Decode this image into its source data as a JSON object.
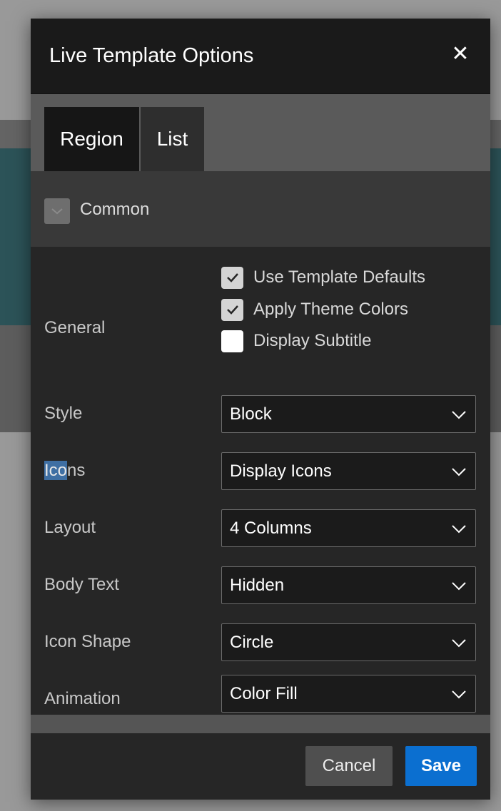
{
  "dialog": {
    "title": "Live Template Options",
    "close_glyph": "✕",
    "close_icon": "close-icon"
  },
  "tabs": [
    {
      "label": "Region",
      "active": true
    },
    {
      "label": "List",
      "active": false
    }
  ],
  "section": {
    "label": "Common",
    "toggle_icon": "chevron-down-icon"
  },
  "general": {
    "label": "General",
    "options": [
      {
        "label": "Use Template Defaults",
        "checked": true
      },
      {
        "label": "Apply Theme Colors",
        "checked": true
      },
      {
        "label": "Display Subtitle",
        "checked": false
      }
    ]
  },
  "fields": [
    {
      "label": "Style",
      "value": "Block"
    },
    {
      "label_highlighted": "Ico",
      "label_rest": "ns",
      "value": "Display Icons"
    },
    {
      "label": "Layout",
      "value": "4 Columns"
    },
    {
      "label": "Body Text",
      "value": "Hidden"
    },
    {
      "label": "Icon Shape",
      "value": "Circle"
    },
    {
      "label": "Animation",
      "value": "Color Fill"
    }
  ],
  "footer": {
    "cancel_label": "Cancel",
    "save_label": "Save"
  },
  "colors": {
    "accent": "#0b6fd0",
    "dialog_bg": "#262626",
    "title_bg": "#1a1a1a",
    "teal_background": "#0e6470"
  }
}
